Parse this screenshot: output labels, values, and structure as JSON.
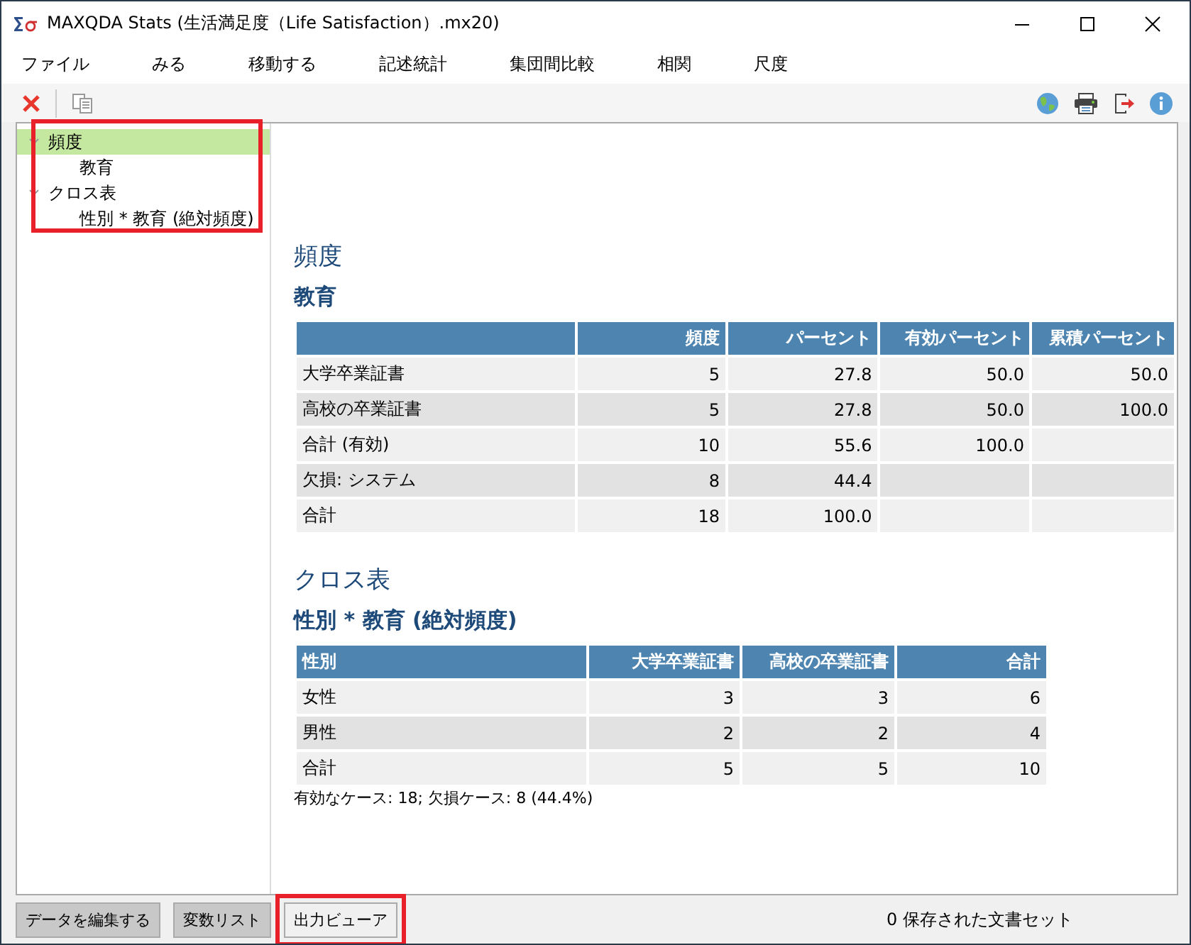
{
  "window": {
    "title": "MAXQDA Stats (生活満足度（Life Satisfaction）.mx20)"
  },
  "menu": [
    "ファイル",
    "みる",
    "移動する",
    "記述統計",
    "集団間比較",
    "相関",
    "尺度"
  ],
  "tree": [
    {
      "label": "頻度",
      "selected": true,
      "expanded": true,
      "children": [
        {
          "label": "教育",
          "selected": false
        }
      ]
    },
    {
      "label": "クロス表",
      "selected": false,
      "expanded": true,
      "children": [
        {
          "label": "性別 * 教育 (絶対頻度)",
          "selected": false
        }
      ]
    }
  ],
  "sections": [
    {
      "heading": "頻度",
      "tables": [
        {
          "title": "教育",
          "columns": [
            "",
            "頻度",
            "パーセント",
            "有効パーセント",
            "累積パーセント"
          ],
          "rows": [
            [
              "大学卒業証書",
              "5",
              "27.8",
              "50.0",
              "50.0"
            ],
            [
              "高校の卒業証書",
              "5",
              "27.8",
              "50.0",
              "100.0"
            ],
            [
              "合計 (有効)",
              "10",
              "55.6",
              "100.0",
              ""
            ],
            [
              "欠損: システム",
              "8",
              "44.4",
              "",
              ""
            ],
            [
              "合計",
              "18",
              "100.0",
              "",
              ""
            ]
          ]
        }
      ]
    },
    {
      "heading": "クロス表",
      "tables": [
        {
          "title": "性別 * 教育 (絶対頻度)",
          "columns": [
            "性別",
            "大学卒業証書",
            "高校の卒業証書",
            "合計"
          ],
          "rows": [
            [
              "女性",
              "3",
              "3",
              "6"
            ],
            [
              "男性",
              "2",
              "2",
              "4"
            ],
            [
              "合計",
              "5",
              "5",
              "10"
            ]
          ],
          "note": "有効なケース: 18; 欠損ケース: 8 (44.4%)"
        }
      ]
    }
  ],
  "bottom_tabs": [
    {
      "label": "データを編集する",
      "selected": false
    },
    {
      "label": "変数リスト",
      "selected": false
    },
    {
      "label": "出力ビューア",
      "selected": true
    }
  ],
  "status": "0 保存された文書セット"
}
